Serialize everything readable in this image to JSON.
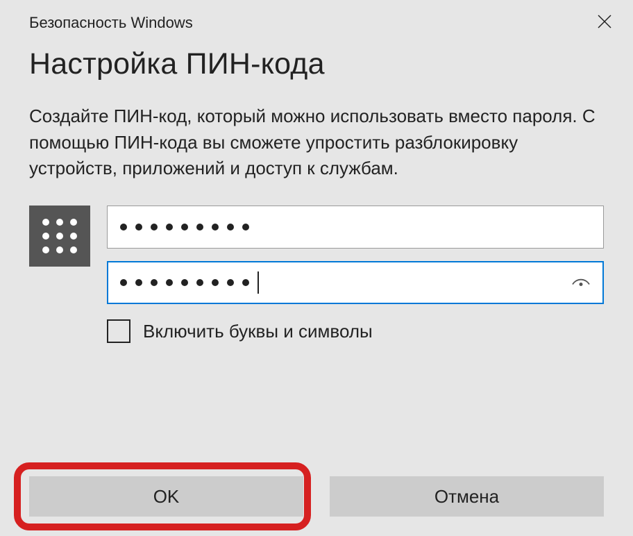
{
  "titlebar": {
    "text": "Безопасность Windows"
  },
  "dialog": {
    "title": "Настройка ПИН-кода",
    "description": "Создайте ПИН-код, который можно использовать вместо пароля. С помощью ПИН-кода вы сможете упростить разблокировку устройств, приложений и доступ к службам."
  },
  "inputs": {
    "pin1_dots": 9,
    "pin2_dots": 9
  },
  "checkbox": {
    "label": "Включить буквы и символы",
    "checked": false
  },
  "buttons": {
    "ok": "OK",
    "cancel": "Отмена"
  }
}
